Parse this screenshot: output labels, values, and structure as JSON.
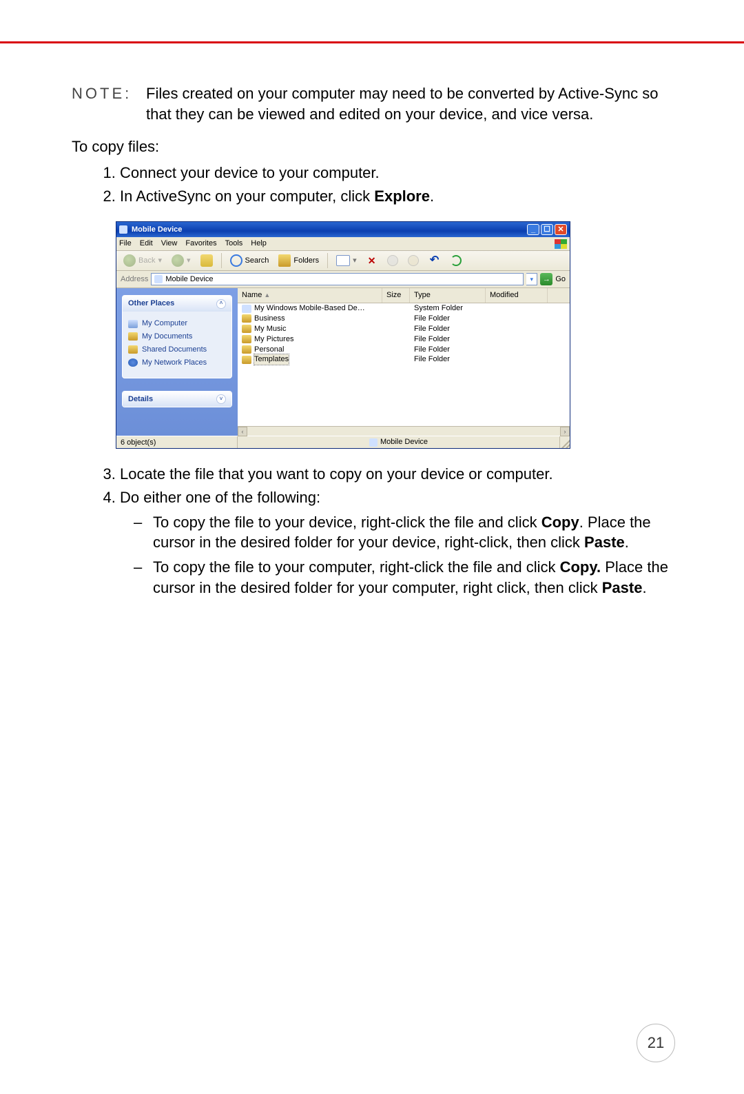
{
  "note_label": "NOTE:",
  "note_body": "Files created on your computer may need to be converted by Active-Sync so that they can be viewed and edited on your device, and vice versa.",
  "copy_intro": "To copy files:",
  "step1": "Connect your device to your computer.",
  "step2_pre": "In ActiveSync on your computer, click ",
  "step2_bold": "Explore",
  "step2_post": ".",
  "step3": "Locate the file that you want to copy on your device or computer.",
  "step4": "Do either one of the following:",
  "sub1_a": "To copy the file to your device, right-click the file and click ",
  "sub1_b": "Copy",
  "sub1_c": ". Place the cursor in the desired folder for your device, right-click, then click ",
  "sub1_d": "Paste",
  "sub1_e": ".",
  "sub2_a": "To copy the file to your computer, right-click the file and click ",
  "sub2_b": "Copy.",
  "sub2_c": " Place the cursor in the desired folder for your computer, right click, then click ",
  "sub2_d": "Paste",
  "sub2_e": ".",
  "page_number": "21",
  "win": {
    "title": "Mobile Device",
    "menus": {
      "file": "File",
      "edit": "Edit",
      "view": "View",
      "fav": "Favorites",
      "tools": "Tools",
      "help": "Help"
    },
    "toolbar": {
      "back": "Back",
      "search": "Search",
      "folders": "Folders"
    },
    "address_label": "Address",
    "address_value": "Mobile Device",
    "go_label": "Go",
    "side": {
      "other_places": "Other Places",
      "details": "Details",
      "items": {
        "my_computer": "My Computer",
        "my_documents": "My Documents",
        "shared_documents": "Shared Documents",
        "my_network_places": "My Network Places"
      }
    },
    "cols": {
      "name": "Name",
      "size": "Size",
      "type": "Type",
      "modified": "Modified"
    },
    "rows": [
      {
        "name": "My Windows Mobile-Based De…",
        "type": "System Folder",
        "sys": true
      },
      {
        "name": "Business",
        "type": "File Folder"
      },
      {
        "name": "My Music",
        "type": "File Folder"
      },
      {
        "name": "My Pictures",
        "type": "File Folder"
      },
      {
        "name": "Personal",
        "type": "File Folder"
      },
      {
        "name": "Templates",
        "type": "File Folder",
        "selected": true
      }
    ],
    "status_objects": "6 object(s)",
    "status_location": "Mobile Device"
  }
}
